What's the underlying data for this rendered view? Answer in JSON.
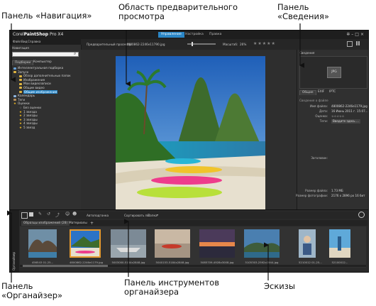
{
  "callouts": {
    "nav_panel": [
      "Панель «Навигация»"
    ],
    "preview_area": [
      "Область предварительного",
      "просмотра"
    ],
    "info_panel": [
      "Панель",
      "«Сведения»"
    ],
    "organizer_panel": [
      "Панель",
      "«Органайзер»"
    ],
    "organizer_toolbar": [
      "Панель инструментов",
      "органайзера"
    ],
    "thumbnails": [
      "Эскизы"
    ]
  },
  "app": {
    "name_prefix": "Corel",
    "name_main": "PaintShop",
    "name_suffix": "Pro X4",
    "tabs": [
      {
        "label": "Управление",
        "active": true
      },
      {
        "label": "Настройка",
        "active": false
      },
      {
        "label": "Правка",
        "active": false
      }
    ],
    "menu": [
      "Файл",
      "Вид",
      "Справка"
    ]
  },
  "toolbar": {
    "preview_label": "Предварительный просмотр",
    "filename": "4800862-2246e11790.jpg",
    "zoom_label": "Масштаб:",
    "zoom_value": "26%",
    "rating": 0,
    "accent_color": "#2a86c6"
  },
  "nav": {
    "title": "Навигация",
    "search_placeholder": "",
    "tabs": [
      {
        "label": "Подборки",
        "active": true
      },
      {
        "label": "Компьютер",
        "active": false
      }
    ],
    "tree": [
      {
        "label": "Интеллектуальная подборка",
        "indent": 0,
        "icon": "smart-collection-icon"
      },
      {
        "label": "Запуск",
        "indent": 0,
        "icon": "folder-icon"
      },
      {
        "label": "Обзор дополнительных папок",
        "indent": 1,
        "icon": "folder-icon"
      },
      {
        "label": "Изображения",
        "indent": 1,
        "icon": "folder-icon"
      },
      {
        "label": "Мои видеозаписи",
        "indent": 1,
        "icon": "folder-icon"
      },
      {
        "label": "Общие видео",
        "indent": 1,
        "icon": "folder-icon"
      },
      {
        "label": "Общие изображения",
        "indent": 1,
        "icon": "folder-icon",
        "selected": true
      },
      {
        "label": "Календарь",
        "indent": 0,
        "icon": "calendar-icon"
      },
      {
        "label": "Теги",
        "indent": 0,
        "icon": "tag-icon"
      },
      {
        "label": "Оценки",
        "indent": 0,
        "icon": "star-icon"
      },
      {
        "label": "Без оценки",
        "indent": 1,
        "icon": "star-empty-icon"
      },
      {
        "label": "1 звезда",
        "indent": 1,
        "icon": "star-icon"
      },
      {
        "label": "2 звезды",
        "indent": 1,
        "icon": "star-icon"
      },
      {
        "label": "3 звезды",
        "indent": 1,
        "icon": "star-icon"
      },
      {
        "label": "4 звезды",
        "indent": 1,
        "icon": "star-icon"
      },
      {
        "label": "5 звезд",
        "indent": 1,
        "icon": "star-icon"
      }
    ]
  },
  "info": {
    "title": "Сведения",
    "format_badge": "JPG",
    "tabs": [
      {
        "label": "Общие",
        "active": true
      },
      {
        "label": "EXIF",
        "active": false
      },
      {
        "label": "IPTC",
        "active": false
      }
    ],
    "section": "Сведения о файле",
    "rows": [
      {
        "key": "Имя файла:",
        "value": "4800862-2246e1179.jpg"
      },
      {
        "key": "Дата:",
        "value": "16 Июнь 2011 г. 15:07..."
      },
      {
        "key": "Оценка:",
        "value": "☆☆☆☆☆"
      },
      {
        "key": "Теги:",
        "value": "Введите здесь ..."
      },
      {
        "key": "Заголовок:",
        "value": ""
      },
      {
        "key": "Размер файла:",
        "value": "1.73 МБ"
      },
      {
        "key": "Размер фотографии:",
        "value": "2176 x 2896 px 16 бит"
      }
    ]
  },
  "organizer": {
    "toolbar_labels": [
      "Автоподгонка",
      "Сортировать по:",
      "Папка"
    ],
    "tabs": [
      {
        "label": "Образцы изображений (28)",
        "active": true
      },
      {
        "label": "Материалы",
        "active": false
      },
      {
        "label": "+",
        "active": false
      }
    ],
    "side_label": "Органайзер",
    "thumbs": [
      {
        "caption": "456543 01-25...",
        "kind": "rocks"
      },
      {
        "caption": "4800862-2246e1179.jpg",
        "kind": "beach",
        "selected": true
      },
      {
        "caption": "5003000-5184x2848.jpg",
        "kind": "boats"
      },
      {
        "caption": "5040153-5184x2848.jpg",
        "kind": "kayak"
      },
      {
        "caption": "5085709-4928x3008.jpg",
        "kind": "sunset"
      },
      {
        "caption": "5105303-2592x1944.jpg",
        "kind": "coast"
      },
      {
        "caption": "5210012 01-25...",
        "kind": "portrait"
      },
      {
        "caption": "52100012...",
        "kind": "surf"
      }
    ]
  }
}
